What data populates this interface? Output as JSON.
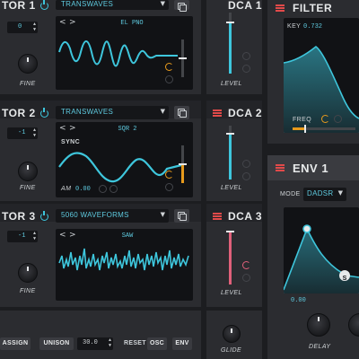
{
  "osc1": {
    "title": "TOR 1",
    "wave_select": "TRANSWAVES",
    "wave_name": "EL PNO",
    "num": "0",
    "fine": "FINE"
  },
  "osc2": {
    "title": "TOR 2",
    "wave_select": "TRANSWAVES",
    "wave_name": "SQR 2",
    "sync": "SYNC",
    "am_label": "AM",
    "am_value": "0.00",
    "num": "-1",
    "fine": "FINE"
  },
  "osc3": {
    "title": "TOR 3",
    "wave_select": "5060 WAVEFORMS",
    "wave_name": "SAW",
    "num": "-1",
    "fine": "FINE"
  },
  "dca1": {
    "title": "DCA 1",
    "level": "LEVEL"
  },
  "dca2": {
    "title": "DCA 2",
    "level": "LEVEL"
  },
  "dca3": {
    "title": "DCA 3",
    "level": "LEVEL"
  },
  "filter": {
    "title": "FILTER",
    "key_label": "KEY",
    "key_value": "0.732",
    "freq": "FREQ"
  },
  "env1": {
    "title": "ENV 1",
    "mode_label": "MODE",
    "mode_value": "DADSR",
    "value": "0.00",
    "delay": "DELAY",
    "point_label": "S"
  },
  "bottom": {
    "assign": "ASSIGN",
    "unison": "UNISON",
    "unison_value": "30.0",
    "reset": "RESET",
    "osc": "OSC",
    "env": "ENV",
    "glide": "GLIDE"
  },
  "nav": {
    "prev": "<",
    "next": ">"
  },
  "icons": {
    "power": "power-icon",
    "copy": "copy-icon",
    "menu": "menu-icon",
    "dropdown": "chevron-down-icon"
  },
  "colors": {
    "accent": "#3ec6dc",
    "orange": "#e79a1c",
    "pink": "#e0607a",
    "red": "#e14a4a"
  }
}
